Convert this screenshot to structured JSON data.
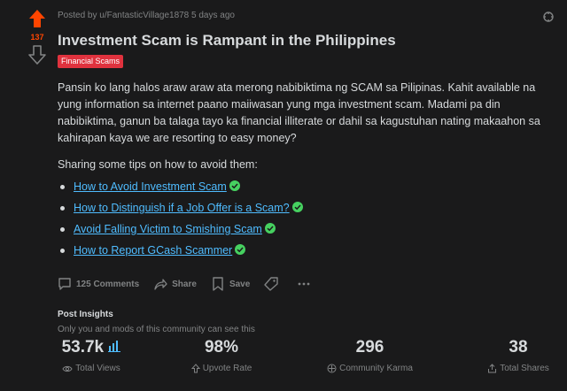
{
  "post": {
    "score": "137",
    "meta": "Posted by u/FantasticVillage1878 5 days ago",
    "title": "Investment Scam is Rampant in the Philippines",
    "flair": "Financial Scams",
    "body": "Pansin ko lang halos araw araw ata merong nabibiktima ng SCAM sa Pilipinas. Kahit available na yung information sa internet paano maiiwasan yung mga investment scam. Madami pa din nabibiktima, ganun ba talaga tayo ka financial illiterate or dahil sa kagustuhan nating makaahon sa kahirapan kaya we are resorting to easy money?",
    "tips_heading": "Sharing some tips on how to avoid them:",
    "tips": [
      "How to Avoid Investment Scam",
      "How to Distinguish if a Job Offer is a Scam?",
      "Avoid Falling Victim to Smishing Scam",
      "How to Report GCash Scammer"
    ]
  },
  "actions": {
    "comments": "125 Comments",
    "share": "Share",
    "save": "Save"
  },
  "insights": {
    "title": "Post Insights",
    "subtitle": "Only you and mods of this community can see this",
    "stats": [
      {
        "value": "53.7k",
        "label": "Total Views",
        "icon": "eye-icon"
      },
      {
        "value": "98%",
        "label": "Upvote Rate",
        "icon": "upvote-outline-icon"
      },
      {
        "value": "296",
        "label": "Community Karma",
        "icon": "karma-icon"
      },
      {
        "value": "38",
        "label": "Total Shares",
        "icon": "share-up-icon"
      }
    ]
  },
  "colors": {
    "background": "#1a1a1b",
    "upvote": "#ff4500",
    "link": "#4fbcff",
    "flair": "#e0323e",
    "check": "#46d160"
  }
}
